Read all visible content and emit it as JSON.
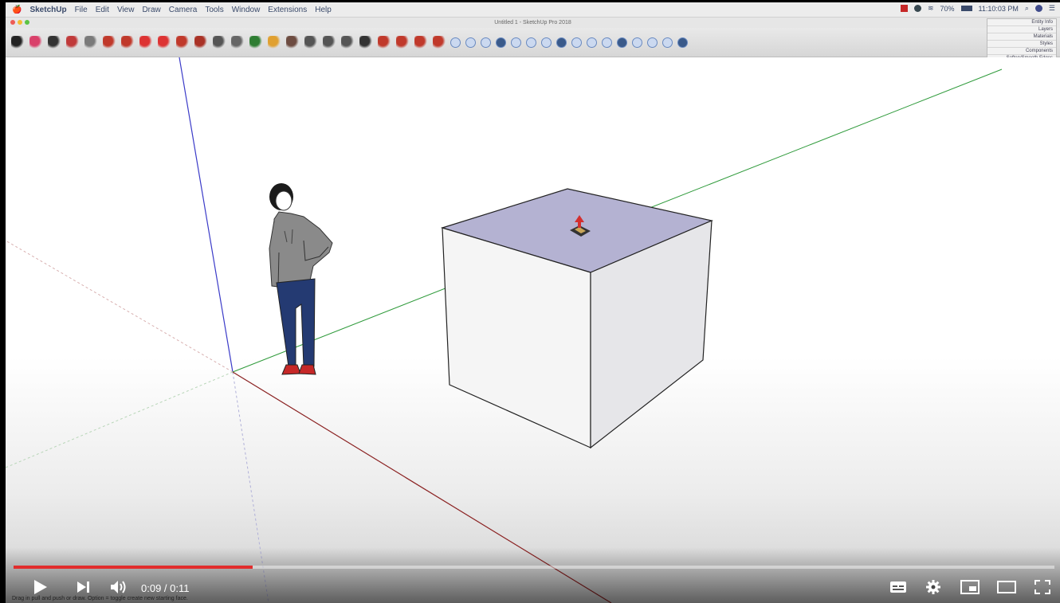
{
  "menubar": {
    "apple_label": "🍎",
    "app_name": "SketchUp",
    "items": [
      "File",
      "Edit",
      "View",
      "Draw",
      "Camera",
      "Tools",
      "Window",
      "Extensions",
      "Help"
    ],
    "status": {
      "battery": "70%",
      "clock": "11:10:03 PM"
    }
  },
  "window": {
    "title": "Untitled 1 - SketchUp Pro 2018"
  },
  "toolbar": {
    "icons": [
      {
        "icon": "select-icon",
        "color": "#222222"
      },
      {
        "icon": "eraser-icon",
        "color": "#d9406a"
      },
      {
        "icon": "line-icon",
        "color": "#333333"
      },
      {
        "icon": "arc-icon",
        "color": "#c03a3a"
      },
      {
        "icon": "shape-icon",
        "color": "#7a7a7a"
      },
      {
        "icon": "push-pull-icon",
        "color": "#c0392b"
      },
      {
        "icon": "offset-icon",
        "color": "#c0392b"
      },
      {
        "icon": "move-icon",
        "color": "#d33"
      },
      {
        "icon": "rotate-icon",
        "color": "#d33"
      },
      {
        "icon": "scale-icon",
        "color": "#c0392b"
      },
      {
        "icon": "paint-bucket-icon",
        "color": "#a93226"
      },
      {
        "icon": "tape-measure-icon",
        "color": "#555555"
      },
      {
        "icon": "text-icon",
        "color": "#666666"
      },
      {
        "icon": "orbit-icon",
        "color": "#2e7d32"
      },
      {
        "icon": "pan-icon",
        "color": "#e0a030"
      },
      {
        "icon": "zoom-icon",
        "color": "#6d4c41"
      },
      {
        "icon": "zoom-extents-icon",
        "color": "#555555"
      },
      {
        "icon": "previous-view-icon",
        "color": "#555555"
      },
      {
        "icon": "search-icon",
        "color": "#555555"
      },
      {
        "icon": "close-icon",
        "color": "#333333"
      },
      {
        "icon": "warehouse-icon",
        "color": "#c0392b"
      },
      {
        "icon": "share-model-icon",
        "color": "#c0392b"
      },
      {
        "icon": "extension-warehouse-icon",
        "color": "#c0392b"
      },
      {
        "icon": "layout-icon",
        "color": "#c0392b"
      }
    ],
    "style_icons": [
      "xray-icon",
      "back-edges-icon",
      "wireframe-icon",
      "hidden-line-icon",
      "shaded-icon",
      "shaded-textures-icon",
      "monochrome-icon",
      "iso-view-icon",
      "top-view-icon",
      "front-view-icon",
      "right-view-icon",
      "back-view-icon",
      "left-view-icon",
      "bottom-view-icon",
      "shadows-icon",
      "ruby-icon"
    ]
  },
  "trays": {
    "items": [
      "Entity Info",
      "Layers",
      "Materials",
      "Styles",
      "Components",
      "Soften/Smooth Edges"
    ]
  },
  "player": {
    "time_current": "0:09",
    "time_total": "0:11",
    "time_separator": " / ",
    "progress": 0.23,
    "status_hint": "Drag in pull and push or draw. Option = toggle create new starting face.",
    "accent": "#e12d2d"
  }
}
